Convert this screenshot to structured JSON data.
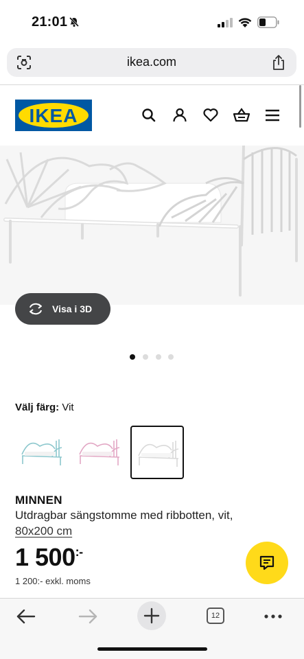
{
  "status_bar": {
    "time": "21:01",
    "icons": [
      "bell-off-icon",
      "cellular-signal-icon",
      "wifi-icon",
      "battery-icon"
    ]
  },
  "browser": {
    "url": "ikea.com",
    "tab_count": "12"
  },
  "header": {
    "logo_text": "IKEA",
    "brand_colors": {
      "blue": "#0058a3",
      "yellow": "#ffdb00"
    },
    "icons": [
      "search-icon",
      "account-icon",
      "wishlist-heart-icon",
      "cart-icon",
      "menu-icon"
    ]
  },
  "gallery": {
    "view_3d_label": "Visa i 3D",
    "dot_count": 4,
    "active_dot": 1
  },
  "colour": {
    "label": "Välj färg:",
    "value": "Vit",
    "options": [
      {
        "name": "turquoise",
        "color": "#8cc7cd",
        "selected": false
      },
      {
        "name": "pink",
        "color": "#e2a7c4",
        "selected": false
      },
      {
        "name": "white",
        "color": "#d9d9d9",
        "selected": true
      }
    ]
  },
  "product": {
    "name": "MINNEN",
    "description": "Utdragbar sängstomme med ribbotten, vit,",
    "size": "80x200 cm",
    "price": "1 500",
    "price_suffix": ":-",
    "price_excl": "1 200:- exkl. moms"
  },
  "chat": {
    "accent": "#ffda1a",
    "icon": "chat-icon"
  },
  "toolbar": {
    "icons": [
      "back-arrow-icon",
      "forward-arrow-icon",
      "new-tab-plus-icon",
      "tabs-icon",
      "more-icon"
    ]
  }
}
